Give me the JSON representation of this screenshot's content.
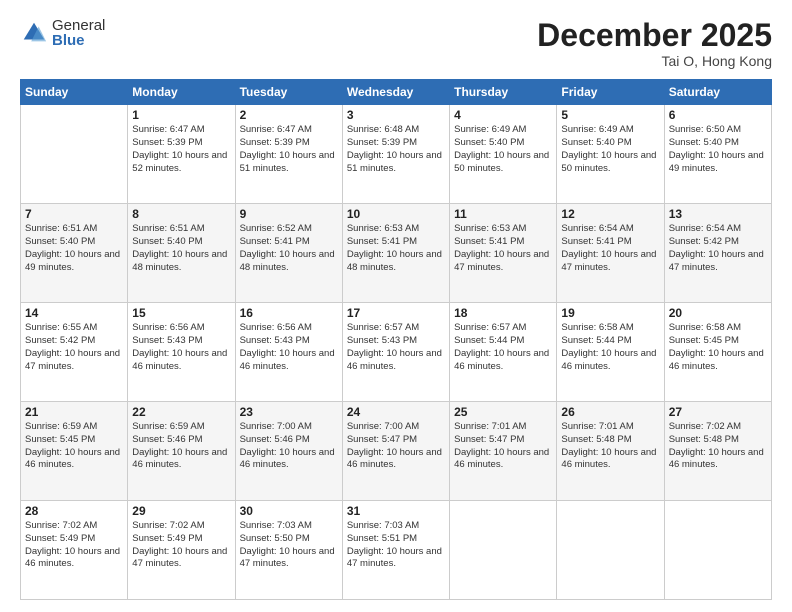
{
  "header": {
    "logo_general": "General",
    "logo_blue": "Blue",
    "month_title": "December 2025",
    "location": "Tai O, Hong Kong"
  },
  "days_of_week": [
    "Sunday",
    "Monday",
    "Tuesday",
    "Wednesday",
    "Thursday",
    "Friday",
    "Saturday"
  ],
  "weeks": [
    [
      {
        "day": "",
        "sunrise": "",
        "sunset": "",
        "daylight": "",
        "empty": true
      },
      {
        "day": "1",
        "sunrise": "Sunrise: 6:47 AM",
        "sunset": "Sunset: 5:39 PM",
        "daylight": "Daylight: 10 hours and 52 minutes."
      },
      {
        "day": "2",
        "sunrise": "Sunrise: 6:47 AM",
        "sunset": "Sunset: 5:39 PM",
        "daylight": "Daylight: 10 hours and 51 minutes."
      },
      {
        "day": "3",
        "sunrise": "Sunrise: 6:48 AM",
        "sunset": "Sunset: 5:39 PM",
        "daylight": "Daylight: 10 hours and 51 minutes."
      },
      {
        "day": "4",
        "sunrise": "Sunrise: 6:49 AM",
        "sunset": "Sunset: 5:40 PM",
        "daylight": "Daylight: 10 hours and 50 minutes."
      },
      {
        "day": "5",
        "sunrise": "Sunrise: 6:49 AM",
        "sunset": "Sunset: 5:40 PM",
        "daylight": "Daylight: 10 hours and 50 minutes."
      },
      {
        "day": "6",
        "sunrise": "Sunrise: 6:50 AM",
        "sunset": "Sunset: 5:40 PM",
        "daylight": "Daylight: 10 hours and 49 minutes."
      }
    ],
    [
      {
        "day": "7",
        "sunrise": "Sunrise: 6:51 AM",
        "sunset": "Sunset: 5:40 PM",
        "daylight": "Daylight: 10 hours and 49 minutes."
      },
      {
        "day": "8",
        "sunrise": "Sunrise: 6:51 AM",
        "sunset": "Sunset: 5:40 PM",
        "daylight": "Daylight: 10 hours and 48 minutes."
      },
      {
        "day": "9",
        "sunrise": "Sunrise: 6:52 AM",
        "sunset": "Sunset: 5:41 PM",
        "daylight": "Daylight: 10 hours and 48 minutes."
      },
      {
        "day": "10",
        "sunrise": "Sunrise: 6:53 AM",
        "sunset": "Sunset: 5:41 PM",
        "daylight": "Daylight: 10 hours and 48 minutes."
      },
      {
        "day": "11",
        "sunrise": "Sunrise: 6:53 AM",
        "sunset": "Sunset: 5:41 PM",
        "daylight": "Daylight: 10 hours and 47 minutes."
      },
      {
        "day": "12",
        "sunrise": "Sunrise: 6:54 AM",
        "sunset": "Sunset: 5:41 PM",
        "daylight": "Daylight: 10 hours and 47 minutes."
      },
      {
        "day": "13",
        "sunrise": "Sunrise: 6:54 AM",
        "sunset": "Sunset: 5:42 PM",
        "daylight": "Daylight: 10 hours and 47 minutes."
      }
    ],
    [
      {
        "day": "14",
        "sunrise": "Sunrise: 6:55 AM",
        "sunset": "Sunset: 5:42 PM",
        "daylight": "Daylight: 10 hours and 47 minutes."
      },
      {
        "day": "15",
        "sunrise": "Sunrise: 6:56 AM",
        "sunset": "Sunset: 5:43 PM",
        "daylight": "Daylight: 10 hours and 46 minutes."
      },
      {
        "day": "16",
        "sunrise": "Sunrise: 6:56 AM",
        "sunset": "Sunset: 5:43 PM",
        "daylight": "Daylight: 10 hours and 46 minutes."
      },
      {
        "day": "17",
        "sunrise": "Sunrise: 6:57 AM",
        "sunset": "Sunset: 5:43 PM",
        "daylight": "Daylight: 10 hours and 46 minutes."
      },
      {
        "day": "18",
        "sunrise": "Sunrise: 6:57 AM",
        "sunset": "Sunset: 5:44 PM",
        "daylight": "Daylight: 10 hours and 46 minutes."
      },
      {
        "day": "19",
        "sunrise": "Sunrise: 6:58 AM",
        "sunset": "Sunset: 5:44 PM",
        "daylight": "Daylight: 10 hours and 46 minutes."
      },
      {
        "day": "20",
        "sunrise": "Sunrise: 6:58 AM",
        "sunset": "Sunset: 5:45 PM",
        "daylight": "Daylight: 10 hours and 46 minutes."
      }
    ],
    [
      {
        "day": "21",
        "sunrise": "Sunrise: 6:59 AM",
        "sunset": "Sunset: 5:45 PM",
        "daylight": "Daylight: 10 hours and 46 minutes."
      },
      {
        "day": "22",
        "sunrise": "Sunrise: 6:59 AM",
        "sunset": "Sunset: 5:46 PM",
        "daylight": "Daylight: 10 hours and 46 minutes."
      },
      {
        "day": "23",
        "sunrise": "Sunrise: 7:00 AM",
        "sunset": "Sunset: 5:46 PM",
        "daylight": "Daylight: 10 hours and 46 minutes."
      },
      {
        "day": "24",
        "sunrise": "Sunrise: 7:00 AM",
        "sunset": "Sunset: 5:47 PM",
        "daylight": "Daylight: 10 hours and 46 minutes."
      },
      {
        "day": "25",
        "sunrise": "Sunrise: 7:01 AM",
        "sunset": "Sunset: 5:47 PM",
        "daylight": "Daylight: 10 hours and 46 minutes."
      },
      {
        "day": "26",
        "sunrise": "Sunrise: 7:01 AM",
        "sunset": "Sunset: 5:48 PM",
        "daylight": "Daylight: 10 hours and 46 minutes."
      },
      {
        "day": "27",
        "sunrise": "Sunrise: 7:02 AM",
        "sunset": "Sunset: 5:48 PM",
        "daylight": "Daylight: 10 hours and 46 minutes."
      }
    ],
    [
      {
        "day": "28",
        "sunrise": "Sunrise: 7:02 AM",
        "sunset": "Sunset: 5:49 PM",
        "daylight": "Daylight: 10 hours and 46 minutes."
      },
      {
        "day": "29",
        "sunrise": "Sunrise: 7:02 AM",
        "sunset": "Sunset: 5:49 PM",
        "daylight": "Daylight: 10 hours and 47 minutes."
      },
      {
        "day": "30",
        "sunrise": "Sunrise: 7:03 AM",
        "sunset": "Sunset: 5:50 PM",
        "daylight": "Daylight: 10 hours and 47 minutes."
      },
      {
        "day": "31",
        "sunrise": "Sunrise: 7:03 AM",
        "sunset": "Sunset: 5:51 PM",
        "daylight": "Daylight: 10 hours and 47 minutes."
      },
      {
        "day": "",
        "sunrise": "",
        "sunset": "",
        "daylight": "",
        "empty": true
      },
      {
        "day": "",
        "sunrise": "",
        "sunset": "",
        "daylight": "",
        "empty": true
      },
      {
        "day": "",
        "sunrise": "",
        "sunset": "",
        "daylight": "",
        "empty": true
      }
    ]
  ]
}
